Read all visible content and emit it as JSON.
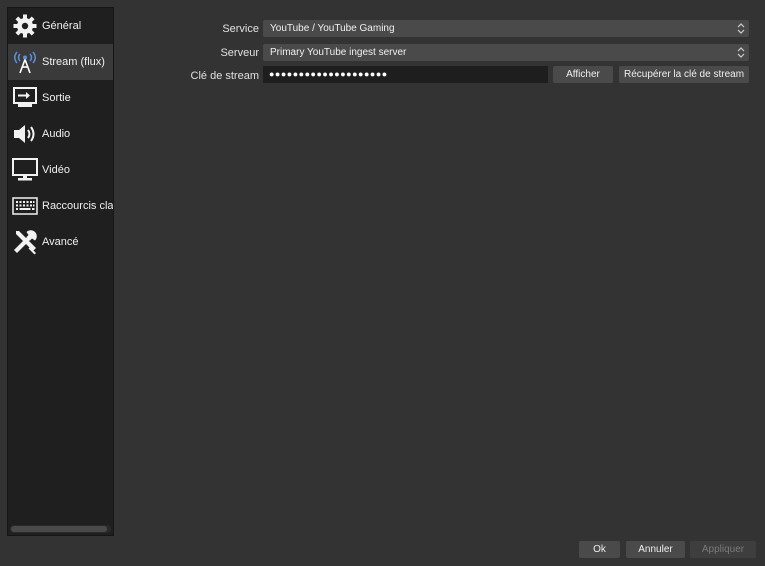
{
  "sidebar": {
    "items": [
      {
        "label": "Général",
        "icon": "gear-icon"
      },
      {
        "label": "Stream (flux)",
        "icon": "broadcast-tower-icon"
      },
      {
        "label": "Sortie",
        "icon": "output-icon"
      },
      {
        "label": "Audio",
        "icon": "speaker-icon"
      },
      {
        "label": "Vidéo",
        "icon": "monitor-icon"
      },
      {
        "label": "Raccourcis clavier",
        "icon": "keyboard-icon"
      },
      {
        "label": "Avancé",
        "icon": "tools-icon"
      }
    ],
    "selected_index": 1
  },
  "stream": {
    "service_label": "Service",
    "service_value": "YouTube / YouTube Gaming",
    "server_label": "Serveur",
    "server_value": "Primary YouTube ingest server",
    "key_label": "Clé de stream",
    "key_value": "●●●●●●●●●●●●●●●●●●●●",
    "show_button": "Afficher",
    "get_key_button": "Récupérer la clé de stream"
  },
  "footer": {
    "ok": "Ok",
    "cancel": "Annuler",
    "apply": "Appliquer"
  },
  "colors": {
    "background": "#333333",
    "sidebar": "#1f1f1f",
    "selected": "#3a3a3a",
    "control": "#4a4a4a",
    "accent_blue": "#5b8fd6"
  }
}
